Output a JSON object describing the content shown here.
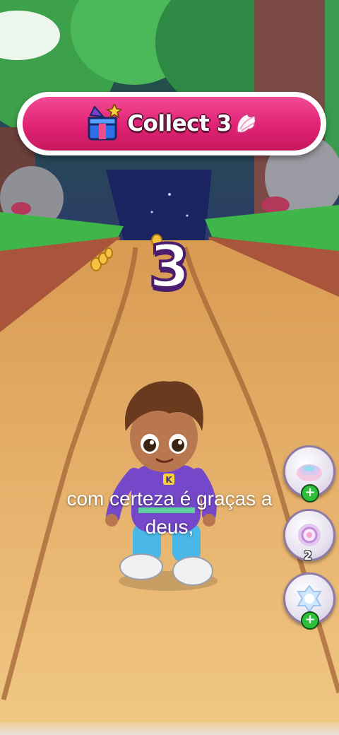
{
  "mission_banner": {
    "text": "Collect 3",
    "icon": "gift-box-icon",
    "target_icon": "wing-icon",
    "color": "#e02274"
  },
  "countdown": {
    "value": "3"
  },
  "subtitle": {
    "line1": "com certeza é graças a",
    "line2": "deus,"
  },
  "powerups": [
    {
      "icon": "magnet-powerup-icon",
      "badge": "+"
    },
    {
      "icon": "coin-doubler-powerup-icon",
      "badge": "2"
    },
    {
      "icon": "shield-powerup-icon",
      "badge": "+"
    }
  ],
  "character": {
    "shirt_letter": "K"
  }
}
